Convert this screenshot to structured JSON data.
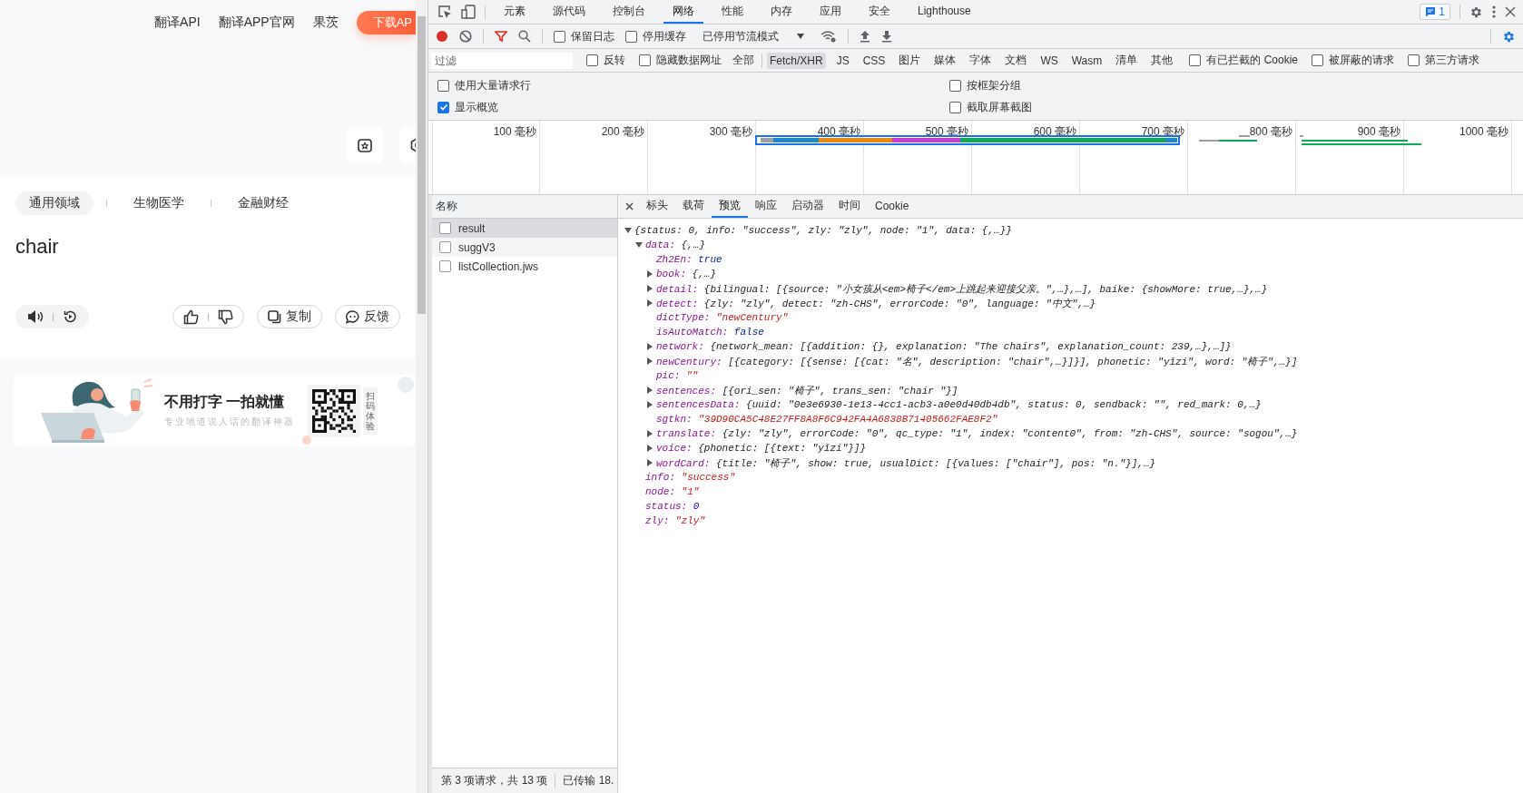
{
  "page": {
    "nav": {
      "links": [
        "翻译API",
        "翻译APP官网",
        "果茨"
      ],
      "download_button": "下载AP"
    },
    "domains": [
      {
        "label": "通用领域",
        "selected": true
      },
      {
        "label": "生物医学",
        "selected": false
      },
      {
        "label": "金融财经",
        "selected": false
      }
    ],
    "result_text": "chair",
    "actions": {
      "copy": "复制",
      "feedback": "反馈"
    },
    "banner": {
      "title": "不用打字 一拍就懂",
      "subtitle": "专业地道说人话的翻译神器",
      "scan_label": "扫码体验"
    }
  },
  "devtools": {
    "tabs": [
      {
        "label": "元素",
        "selected": false
      },
      {
        "label": "源代码",
        "selected": false
      },
      {
        "label": "控制台",
        "selected": false
      },
      {
        "label": "网络",
        "selected": true
      },
      {
        "label": "性能",
        "selected": false
      },
      {
        "label": "内存",
        "selected": false
      },
      {
        "label": "应用",
        "selected": false
      },
      {
        "label": "安全",
        "selected": false
      },
      {
        "label": "Lighthouse",
        "selected": false
      }
    ],
    "issues_badge": "1",
    "toolbar": {
      "recording": true,
      "checkboxes": [
        {
          "label": "保留日志",
          "checked": false
        },
        {
          "label": "停用缓存",
          "checked": false
        }
      ],
      "throttling": "已停用节流模式"
    },
    "filter": {
      "placeholder": "过滤",
      "checkboxes_left": [
        {
          "label": "反转",
          "checked": false
        },
        {
          "label": "隐藏数据网址",
          "checked": false
        }
      ],
      "types": [
        {
          "label": "全部",
          "selected": false
        },
        {
          "label": "Fetch/XHR",
          "selected": true
        },
        {
          "label": "JS",
          "selected": false
        },
        {
          "label": "CSS",
          "selected": false
        },
        {
          "label": "图片",
          "selected": false
        },
        {
          "label": "媒体",
          "selected": false
        },
        {
          "label": "字体",
          "selected": false
        },
        {
          "label": "文档",
          "selected": false
        },
        {
          "label": "WS",
          "selected": false
        },
        {
          "label": "Wasm",
          "selected": false
        },
        {
          "label": "清单",
          "selected": false
        },
        {
          "label": "其他",
          "selected": false
        }
      ],
      "checkboxes_right": [
        {
          "label": "有已拦截的 Cookie",
          "checked": false
        },
        {
          "label": "被屏蔽的请求",
          "checked": false
        },
        {
          "label": "第三方请求",
          "checked": false
        }
      ]
    },
    "options": [
      {
        "label": "使用大量请求行",
        "checked": false
      },
      {
        "label": "按框架分组",
        "checked": false
      },
      {
        "label": "显示概览",
        "checked": true
      },
      {
        "label": "截取屏幕截图",
        "checked": false
      }
    ],
    "overview": {
      "ticks": [
        "100 毫秒",
        "200 毫秒",
        "300 毫秒",
        "400 毫秒",
        "500 毫秒",
        "600 毫秒",
        "700 毫秒",
        "800 毫秒",
        "900 毫秒",
        "1000 毫秒"
      ]
    },
    "requests": {
      "header": "名称",
      "rows": [
        {
          "name": "result",
          "selected": true
        },
        {
          "name": "suggV3",
          "selected": false
        },
        {
          "name": "listCollection.jws",
          "selected": false
        }
      ]
    },
    "status_bar": [
      "第 3 项请求，共 13 项",
      "已传输 18."
    ],
    "detail_tabs": [
      {
        "label": "标头",
        "selected": false
      },
      {
        "label": "载荷",
        "selected": false
      },
      {
        "label": "预览",
        "selected": true
      },
      {
        "label": "响应",
        "selected": false
      },
      {
        "label": "启动器",
        "selected": false
      },
      {
        "label": "时间",
        "selected": false
      },
      {
        "label": "Cookie",
        "selected": false
      }
    ],
    "preview": [
      {
        "value": "{status: 0, info: \"success\", zly: \"zly\", node: \"1\", data: {,…}}",
        "kind": "object",
        "expanded": true,
        "children": [
          {
            "key": "data:",
            "value": "{,…}",
            "kind": "object",
            "expanded": true,
            "children": [
              {
                "key": "Zh2En:",
                "value": "true",
                "kind": "boolean"
              },
              {
                "key": "book:",
                "value": "{,…}",
                "kind": "object",
                "expanded": false
              },
              {
                "key": "detail:",
                "value": "{bilingual: [{source: \"小女孩从<em>椅子</em>上跳起来迎接父亲。\",…},…], baike: {showMore: true,…},…}",
                "kind": "object",
                "expanded": false
              },
              {
                "key": "detect:",
                "value": "{zly: \"zly\", detect: \"zh-CHS\", errorCode: \"0\", language: \"中文\",…}",
                "kind": "object",
                "expanded": false
              },
              {
                "key": "dictType:",
                "value": "\"newCentury\"",
                "kind": "string"
              },
              {
                "key": "isAutoMatch:",
                "value": "false",
                "kind": "boolean"
              },
              {
                "key": "network:",
                "value": "{network_mean: [{addition: {}, explanation: \"The chairs\", explanation_count: 239,…},…]}",
                "kind": "object",
                "expanded": false
              },
              {
                "key": "newCentury:",
                "value": "[{category: [{sense: [{cat: \"名\", description: \"chair\",…}]}], phonetic: \"yǐzi\", word: \"椅子\",…}]",
                "kind": "object",
                "expanded": false
              },
              {
                "key": "pic:",
                "value": "\"\"",
                "kind": "string"
              },
              {
                "key": "sentences:",
                "value": "[{ori_sen: \"椅子\", trans_sen: \"chair \"}]",
                "kind": "object",
                "expanded": false
              },
              {
                "key": "sentencesData:",
                "value": "{uuid: \"0e3e6930-1e13-4cc1-acb3-a0e0d40db4db\", status: 0, sendback: \"\", red_mark: 0,…}",
                "kind": "object",
                "expanded": false
              },
              {
                "key": "sgtkn:",
                "value": "\"39D90CA5C48E27FF8A8F6C942FA4A6838B71405662FAE8F2\"",
                "kind": "string"
              },
              {
                "key": "translate:",
                "value": "{zly: \"zly\", errorCode: \"0\", qc_type: \"1\", index: \"content0\", from: \"zh-CHS\", source: \"sogou\",…}",
                "kind": "object",
                "expanded": false
              },
              {
                "key": "voice:",
                "value": "{phonetic: [{text: \"yǐzi\"}]}",
                "kind": "object",
                "expanded": false
              },
              {
                "key": "wordCard:",
                "value": "{title: \"椅子\", show: true, usualDict: [{values: [\"chair\"], pos: \"n.\"}],…}",
                "kind": "object",
                "expanded": false
              }
            ]
          },
          {
            "key": "info:",
            "value": "\"success\"",
            "kind": "string"
          },
          {
            "key": "node:",
            "value": "\"1\"",
            "kind": "string"
          },
          {
            "key": "status:",
            "value": "0",
            "kind": "number"
          },
          {
            "key": "zly:",
            "value": "\"zly\"",
            "kind": "string"
          }
        ]
      }
    ]
  }
}
